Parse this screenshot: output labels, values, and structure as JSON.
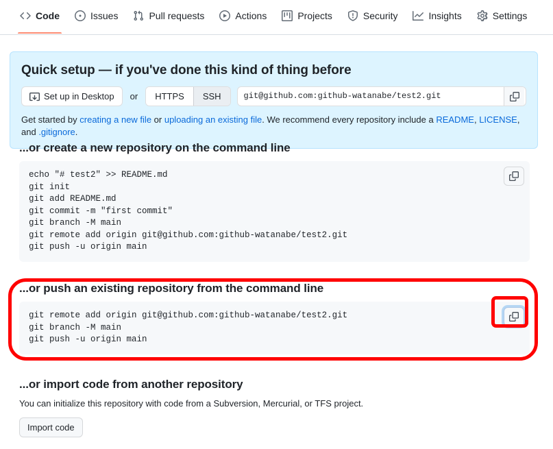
{
  "nav": {
    "items": [
      {
        "label": "Code",
        "icon": "code-icon",
        "active": true
      },
      {
        "label": "Issues",
        "icon": "issue-opened-icon",
        "active": false
      },
      {
        "label": "Pull requests",
        "icon": "git-pull-request-icon",
        "active": false
      },
      {
        "label": "Actions",
        "icon": "play-icon",
        "active": false
      },
      {
        "label": "Projects",
        "icon": "project-board-icon",
        "active": false
      },
      {
        "label": "Security",
        "icon": "shield-icon",
        "active": false
      },
      {
        "label": "Insights",
        "icon": "graph-icon",
        "active": false
      },
      {
        "label": "Settings",
        "icon": "gear-icon",
        "active": false
      }
    ]
  },
  "quick_setup": {
    "title": "Quick setup — if you've done this kind of thing before",
    "desktop_button": "Set up in Desktop",
    "or": "or",
    "protocols": [
      {
        "label": "HTTPS",
        "selected": false
      },
      {
        "label": "SSH",
        "selected": true
      }
    ],
    "remote_url": "git@github.com:github-watanabe/test2.git",
    "copy_icon": "clipboard-icon",
    "help": {
      "prefix": "Get started by ",
      "link1": "creating a new file",
      "mid1": " or ",
      "link2": "uploading an existing file",
      "mid2": ". We recommend every repository include a ",
      "link3": "README",
      "mid3": ", ",
      "link4": "LICENSE",
      "mid4": ", and ",
      "link5": ".gitignore",
      "suffix": "."
    }
  },
  "create_section": {
    "title": "...or create a new repository on the command line",
    "copy_icon": "clipboard-icon",
    "lines": [
      "echo \"# test2\" >> README.md",
      "git init",
      "git add README.md",
      "git commit -m \"first commit\"",
      "git branch -M main",
      "git remote add origin git@github.com:github-watanabe/test2.git",
      "git push -u origin main"
    ]
  },
  "push_section": {
    "title": "...or push an existing repository from the command line",
    "copy_icon": "clipboard-icon",
    "lines": [
      "git remote add origin git@github.com:github-watanabe/test2.git",
      "git branch -M main",
      "git push -u origin main"
    ]
  },
  "import_section": {
    "title": "...or import code from another repository",
    "description": "You can initialize this repository with code from a Subversion, Mercurial, or TFS project.",
    "button": "Import code"
  },
  "annotations": {
    "highlight_color": "#ff0000",
    "focus_ring_color": "#b6d7f4"
  }
}
